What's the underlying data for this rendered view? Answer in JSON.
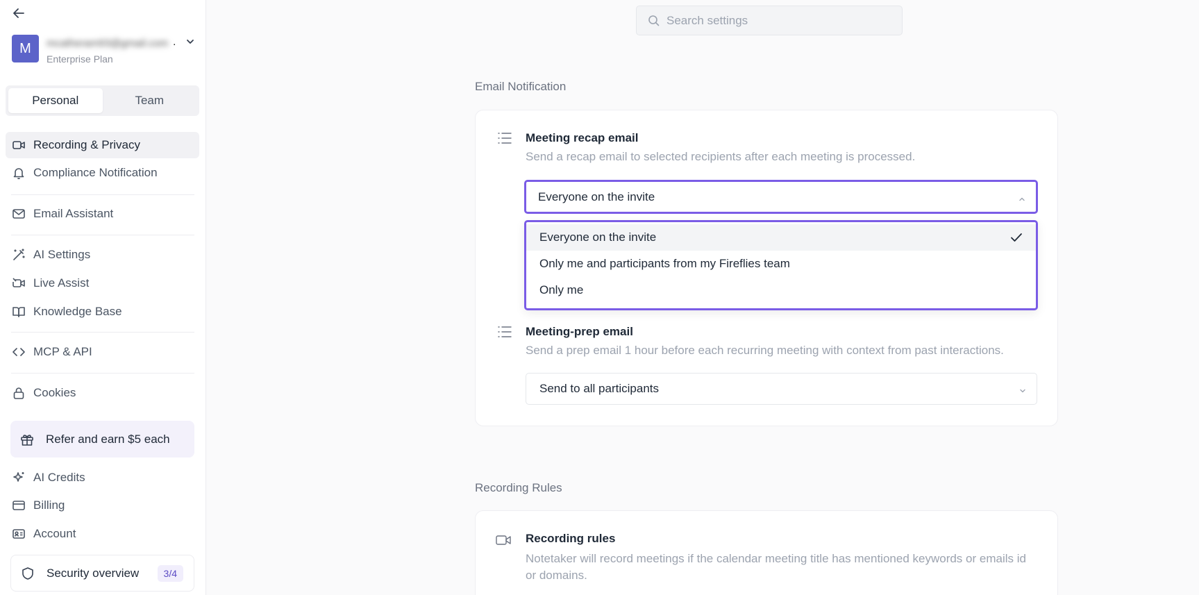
{
  "sidebar": {
    "account": {
      "avatar_letter": "M",
      "email": "mcatheram93@gmail.com",
      "email_ellipsis": ".",
      "plan": "Enterprise Plan"
    },
    "tabs": [
      {
        "label": "Personal",
        "active": true
      },
      {
        "label": "Team",
        "active": false
      }
    ],
    "items": [
      {
        "label": "Recording & Privacy",
        "icon": "video-camera-icon",
        "active": true
      },
      {
        "label": "Compliance Notification",
        "icon": "bell-icon"
      },
      {
        "label": "Email Assistant",
        "icon": "mail-icon"
      },
      {
        "label": "AI Settings",
        "icon": "magic-wand-icon"
      },
      {
        "label": "Live Assist",
        "icon": "video-off-icon"
      },
      {
        "label": "Knowledge Base",
        "icon": "book-icon"
      },
      {
        "label": "MCP & API",
        "icon": "code-icon"
      },
      {
        "label": "Cookies",
        "icon": "lock-icon"
      },
      {
        "label": "AI Credits",
        "icon": "sparkle-icon"
      },
      {
        "label": "Billing",
        "icon": "credit-card-icon"
      },
      {
        "label": "Account",
        "icon": "id-card-icon"
      }
    ],
    "refer_label": "Refer and earn $5 each",
    "security": {
      "label": "Security overview",
      "badge": "3/4"
    }
  },
  "search": {
    "placeholder": "Search settings"
  },
  "sections": {
    "email_notification": {
      "title": "Email Notification",
      "recap": {
        "title": "Meeting recap email",
        "description": "Send a recap email to selected recipients after each meeting is processed.",
        "selected": "Everyone on the invite",
        "options": [
          {
            "label": "Everyone on the invite",
            "selected": true
          },
          {
            "label": "Only me and participants from my Fireflies team",
            "selected": false
          },
          {
            "label": "Only me",
            "selected": false
          }
        ]
      },
      "prep": {
        "title": "Meeting-prep email",
        "description": "Send a prep email 1 hour before each recurring meeting with context from past interactions.",
        "selected": "Send to all participants"
      }
    },
    "recording_rules": {
      "title": "Recording Rules",
      "rules": {
        "title": "Recording rules",
        "description": "Notetaker will record meetings if the calendar meeting title has mentioned keywords or emails id or domains."
      }
    }
  },
  "colors": {
    "accent": "#7a5ce6",
    "avatar": "#5c63c9"
  }
}
